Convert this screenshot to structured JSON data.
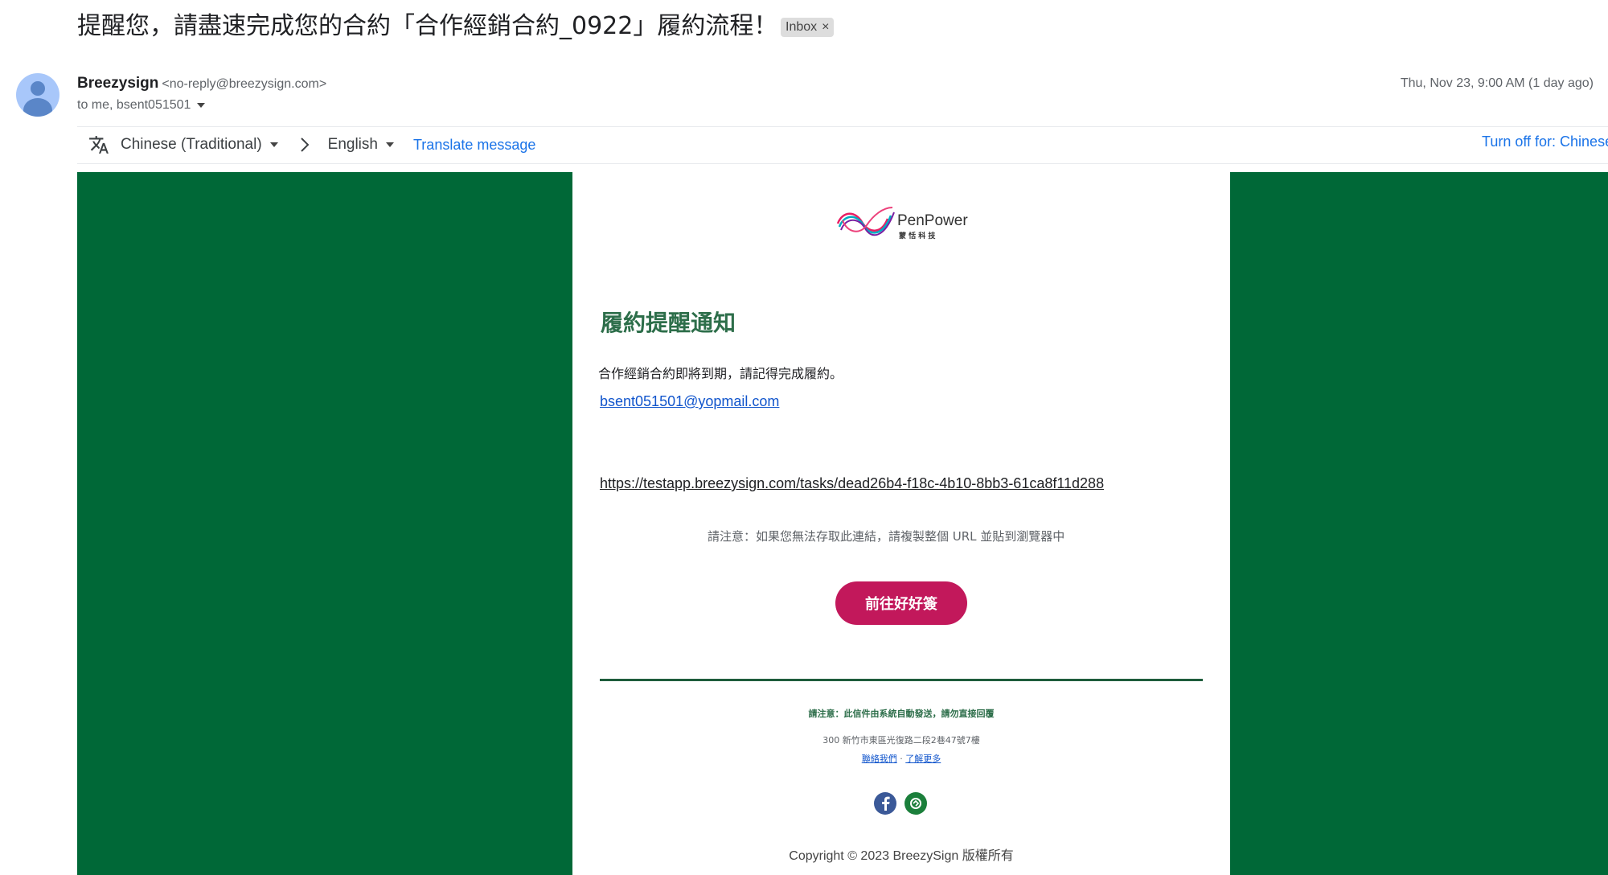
{
  "subject": {
    "title": "提醒您，請盡速完成您的合約「合作經銷合約_0922」履約流程！",
    "label_chip": "Inbox",
    "chip_close": "×"
  },
  "sender": {
    "name": "Breezysign",
    "address": "<no-reply@breezysign.com>",
    "recipients": "to me, bsent051501",
    "date": "Thu, Nov 23, 9:00 AM (1 day ago)"
  },
  "translate_bar": {
    "source_language": "Chinese (Traditional)",
    "target_language": "English",
    "translate_action": "Translate message",
    "turn_off": "Turn off for: Chinese"
  },
  "email": {
    "logo_text": "PenPower",
    "logo_subtext": "蒙 恬 科 技",
    "heading": "履約提醒通知",
    "message": "合作經銷合約即將到期，請記得完成履約。",
    "recipient_email": "bsent051501@yopmail.com",
    "task_url": "https://testapp.breezysign.com/tasks/dead26b4-f18c-4b10-8bb3-61ca8f11d288",
    "url_note": "請注意：如果您無法存取此連結，請複製整個 URL 並貼到瀏覽器中",
    "cta_button": "前往好好簽",
    "footer_note": "請注意：此信件由系統自動發送，請勿直接回覆",
    "footer_address": "300 新竹市東區光復路二段2巷47號7樓",
    "footer_link_contact": "聯絡我們",
    "footer_link_separator": " · ",
    "footer_link_more": "了解更多",
    "copyright": "Copyright © 2023 BreezySign 版權所有"
  },
  "icons": {
    "avatar": "person-icon",
    "translate": "translate-icon",
    "facebook": "facebook-icon",
    "line": "line-icon"
  },
  "colors": {
    "green_background": "#006837",
    "cta_button": "#c2185b",
    "heading": "#2d6e4a",
    "link": "#1a73e8"
  }
}
